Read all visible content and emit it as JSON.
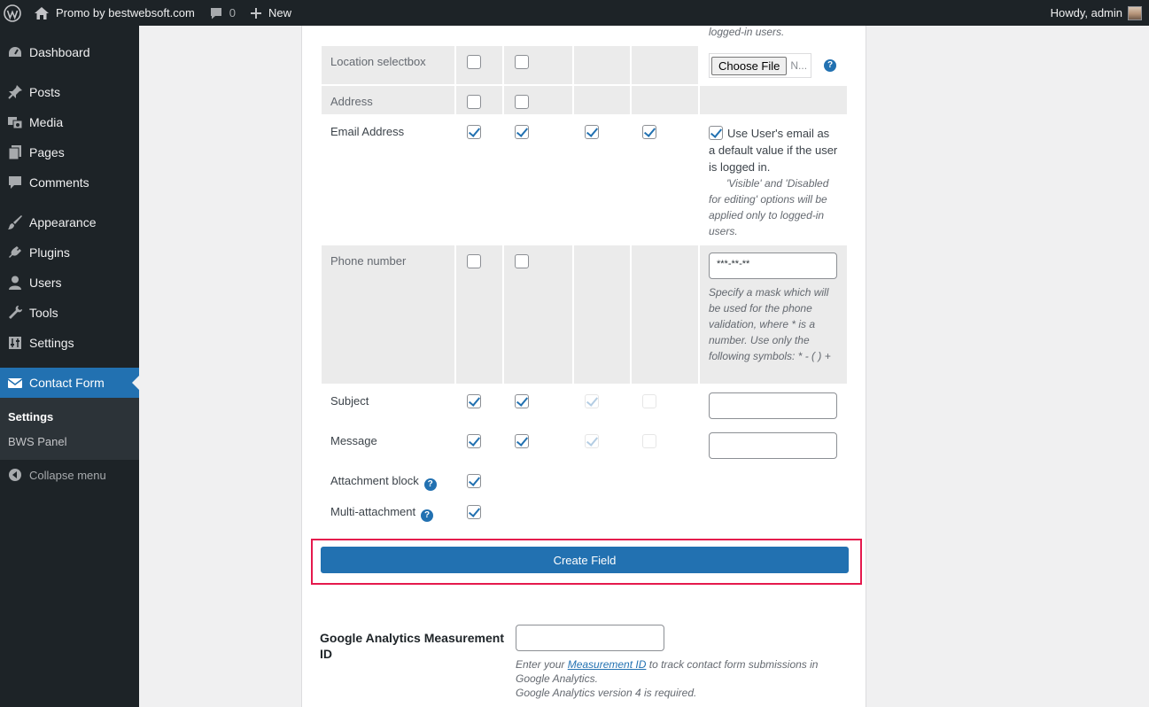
{
  "adminbar": {
    "site_name": "Promo by bestwebsoft.com",
    "comments_count": "0",
    "new_label": "New",
    "greeting": "Howdy, admin"
  },
  "sidebar": {
    "items": [
      {
        "label": "Dashboard",
        "icon": "dashboard-icon"
      },
      {
        "label": "Posts",
        "icon": "pin-icon"
      },
      {
        "label": "Media",
        "icon": "media-icon"
      },
      {
        "label": "Pages",
        "icon": "pages-icon"
      },
      {
        "label": "Comments",
        "icon": "comment-icon"
      },
      {
        "label": "Appearance",
        "icon": "brush-icon"
      },
      {
        "label": "Plugins",
        "icon": "plug-icon"
      },
      {
        "label": "Users",
        "icon": "user-icon"
      },
      {
        "label": "Tools",
        "icon": "wrench-icon"
      },
      {
        "label": "Settings",
        "icon": "sliders-icon"
      },
      {
        "label": "Contact Form",
        "icon": "envelope-icon"
      }
    ],
    "submenu": [
      {
        "label": "Settings"
      },
      {
        "label": "BWS Panel"
      }
    ],
    "collapse_label": "Collapse menu"
  },
  "fields_table": {
    "top_note": "logged-in users.",
    "rows": [
      {
        "name": "Location selectbox",
        "file_button": "Choose File",
        "file_status": "N..."
      },
      {
        "name": "Address"
      },
      {
        "name": "Email Address",
        "option_label": "Use User's email as a default value if the user is logged in.",
        "note": "'Visible' and 'Disabled for editing' options will be applied only to logged-in users."
      },
      {
        "name": "Phone number",
        "mask_value": "***-**-**",
        "note": "Specify a mask which will be used for the phone validation, where * is a number. Use only the following symbols: * - ( ) +"
      },
      {
        "name": "Subject"
      },
      {
        "name": "Message"
      },
      {
        "name": "Attachment block"
      },
      {
        "name": "Multi-attachment"
      }
    ]
  },
  "create_field_label": "Create Field",
  "google_analytics": {
    "label": "Google Analytics Measurement ID",
    "desc_before": "Enter your ",
    "desc_link": "Measurement ID",
    "desc_after": " to track contact form submissions in Google Analytics.",
    "desc_line2": "Google Analytics version 4 is required."
  },
  "colors": {
    "accent": "#2271b1",
    "sidebar_bg": "#1d2327",
    "highlight": "#e5194d"
  }
}
